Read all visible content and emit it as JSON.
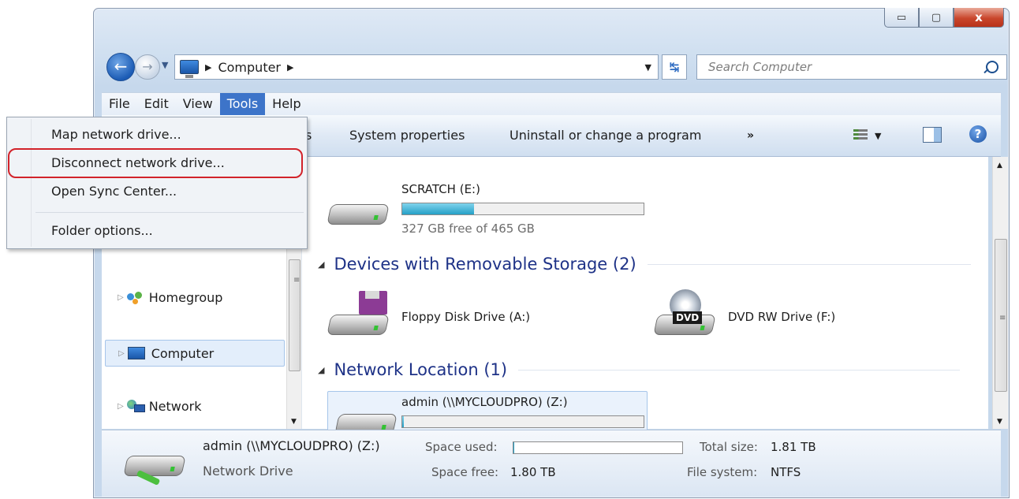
{
  "window": {
    "caption_buttons": {
      "minimize": "▭",
      "maximize": "▢",
      "close": "x"
    }
  },
  "nav": {
    "back_glyph": "←",
    "forward_glyph": "→",
    "breadcrumb": "Computer",
    "search_placeholder": "Search Computer"
  },
  "menubar": {
    "items": [
      "File",
      "Edit",
      "View",
      "Tools",
      "Help"
    ],
    "active": "Tools"
  },
  "cmdbar": {
    "partial": "s",
    "items": [
      "System properties",
      "Uninstall or change a program"
    ],
    "more": "»",
    "help_glyph": "?"
  },
  "tools_menu": {
    "items": [
      "Map network drive...",
      "Disconnect network drive...",
      "Open Sync Center...",
      "Folder options..."
    ],
    "highlighted": "Disconnect network drive...",
    "highlight_color": "#d2232a"
  },
  "navpane": {
    "items": [
      {
        "label": "Homegroup",
        "icon": "homegroup-icon"
      },
      {
        "label": "Computer",
        "icon": "computer-icon",
        "selected": true
      },
      {
        "label": "Network",
        "icon": "network-icon"
      }
    ]
  },
  "content": {
    "hard_disk": {
      "name": "SCRATCH (E:)",
      "free": "327 GB free of 465 GB",
      "used_fraction": 0.297
    },
    "groups": [
      {
        "title": "Devices with Removable Storage (2)"
      },
      {
        "title": "Network Location (1)"
      }
    ],
    "removable": [
      {
        "name": "Floppy Disk Drive (A:)",
        "icon": "floppy-drive-icon"
      },
      {
        "name": "DVD RW Drive (F:)",
        "icon": "dvd-drive-icon",
        "badge": "DVD"
      }
    ],
    "network_drive": {
      "name": "admin (\\\\MYCLOUDPRO) (Z:)",
      "used_fraction": 0.006
    }
  },
  "details": {
    "name": "admin (\\\\MYCLOUDPRO) (Z:)",
    "type": "Network Drive",
    "space_used_label": "Space used:",
    "space_free_label": "Space free:",
    "space_free": "1.80 TB",
    "total_size_label": "Total size:",
    "total_size": "1.81 TB",
    "file_system_label": "File system:",
    "file_system": "NTFS"
  },
  "colors": {
    "accent": "#3d74c9",
    "group_header": "#1e3287",
    "capacity_fill": "#25a0c7"
  }
}
